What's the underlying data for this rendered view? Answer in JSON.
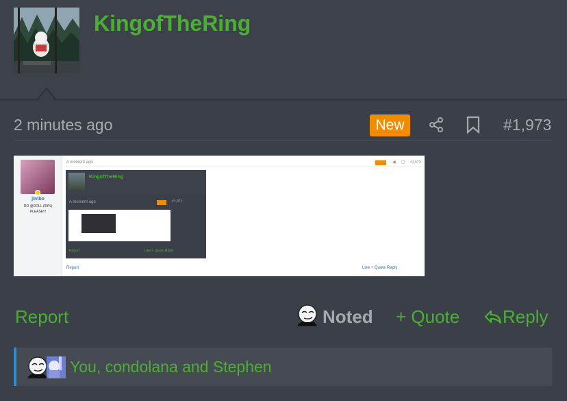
{
  "post": {
    "username": "KingofTheRing",
    "timestamp": "2 minutes ago",
    "badge": "New",
    "post_number": "#1,973",
    "accent_color": "#4caf35",
    "badge_color": "#f08c00"
  },
  "embed": {
    "time": "A moment ago",
    "post_number": "#1,973",
    "user_name": "jimbo",
    "user_title": "DO @DOLL (99%) PLEASE!!!",
    "inner_username": "KingofTheRing",
    "inner_time": "A moment ago",
    "inner_post_number": "#1,971",
    "inner_report": "Report",
    "inner_actions": "Like  + Quote  Reply",
    "report": "Report",
    "actions": "Like  + Quote  Reply"
  },
  "actions": {
    "report_label": "Report",
    "noted_label": "Noted",
    "quote_label": "+ Quote",
    "reply_label": "Reply"
  },
  "reactions": {
    "text": "You, condolana and Stephen"
  },
  "icons": [
    "share-icon",
    "bookmark-icon",
    "reply-icon",
    "meme-face-icon"
  ]
}
